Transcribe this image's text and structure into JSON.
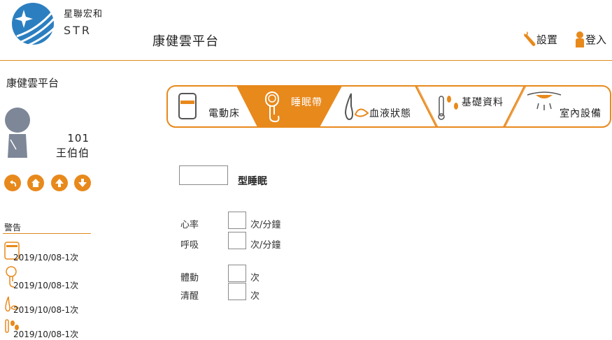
{
  "brand": {
    "name_cn": "星聯宏和",
    "name_en": "STR"
  },
  "header": {
    "title": "康健雲平台",
    "settings_label": "設置",
    "login_label": "登入"
  },
  "sidebar": {
    "title": "康健雲平台",
    "room": "101",
    "patient_name": "王伯伯",
    "nav_buttons": [
      "back-icon",
      "home-icon",
      "up-arrow-icon",
      "down-arrow-icon"
    ],
    "alerts_label": "警告",
    "alerts": [
      {
        "icon": "bed-icon",
        "text": "2019/10/08-1次"
      },
      {
        "icon": "sleep-band-icon",
        "text": "2019/10/08-1次"
      },
      {
        "icon": "blood-drop-icon",
        "text": "2019/10/08-1次"
      },
      {
        "icon": "basic-data-icon",
        "text": "2019/10/08-1次"
      }
    ]
  },
  "tabs": [
    {
      "label": "電動床",
      "icon": "bed-icon",
      "active": false
    },
    {
      "label": "睡眠帶",
      "icon": "sleep-band-icon",
      "active": true
    },
    {
      "label": "血液狀態",
      "icon": "blood-drop-icon",
      "active": false
    },
    {
      "label": "基礎資料",
      "icon": "thermometer-footprint-icon",
      "active": false
    },
    {
      "label": "室內設備",
      "icon": "ceiling-lamp-icon",
      "active": false
    }
  ],
  "sleep": {
    "type_value": "",
    "type_label": "型睡眠",
    "heart_rate_label": "心率",
    "heart_rate_value": "",
    "heart_rate_unit": "次/分鐘",
    "respiration_label": "呼吸",
    "respiration_value": "",
    "respiration_unit": "次/分鐘",
    "movement_label": "體動",
    "movement_value": "",
    "movement_unit": "次",
    "awake_label": "清醒",
    "awake_value": "",
    "awake_unit": "次"
  },
  "colors": {
    "accent": "#e8891c",
    "avatar": "#7d8798",
    "logo": "#2b7fc0"
  }
}
